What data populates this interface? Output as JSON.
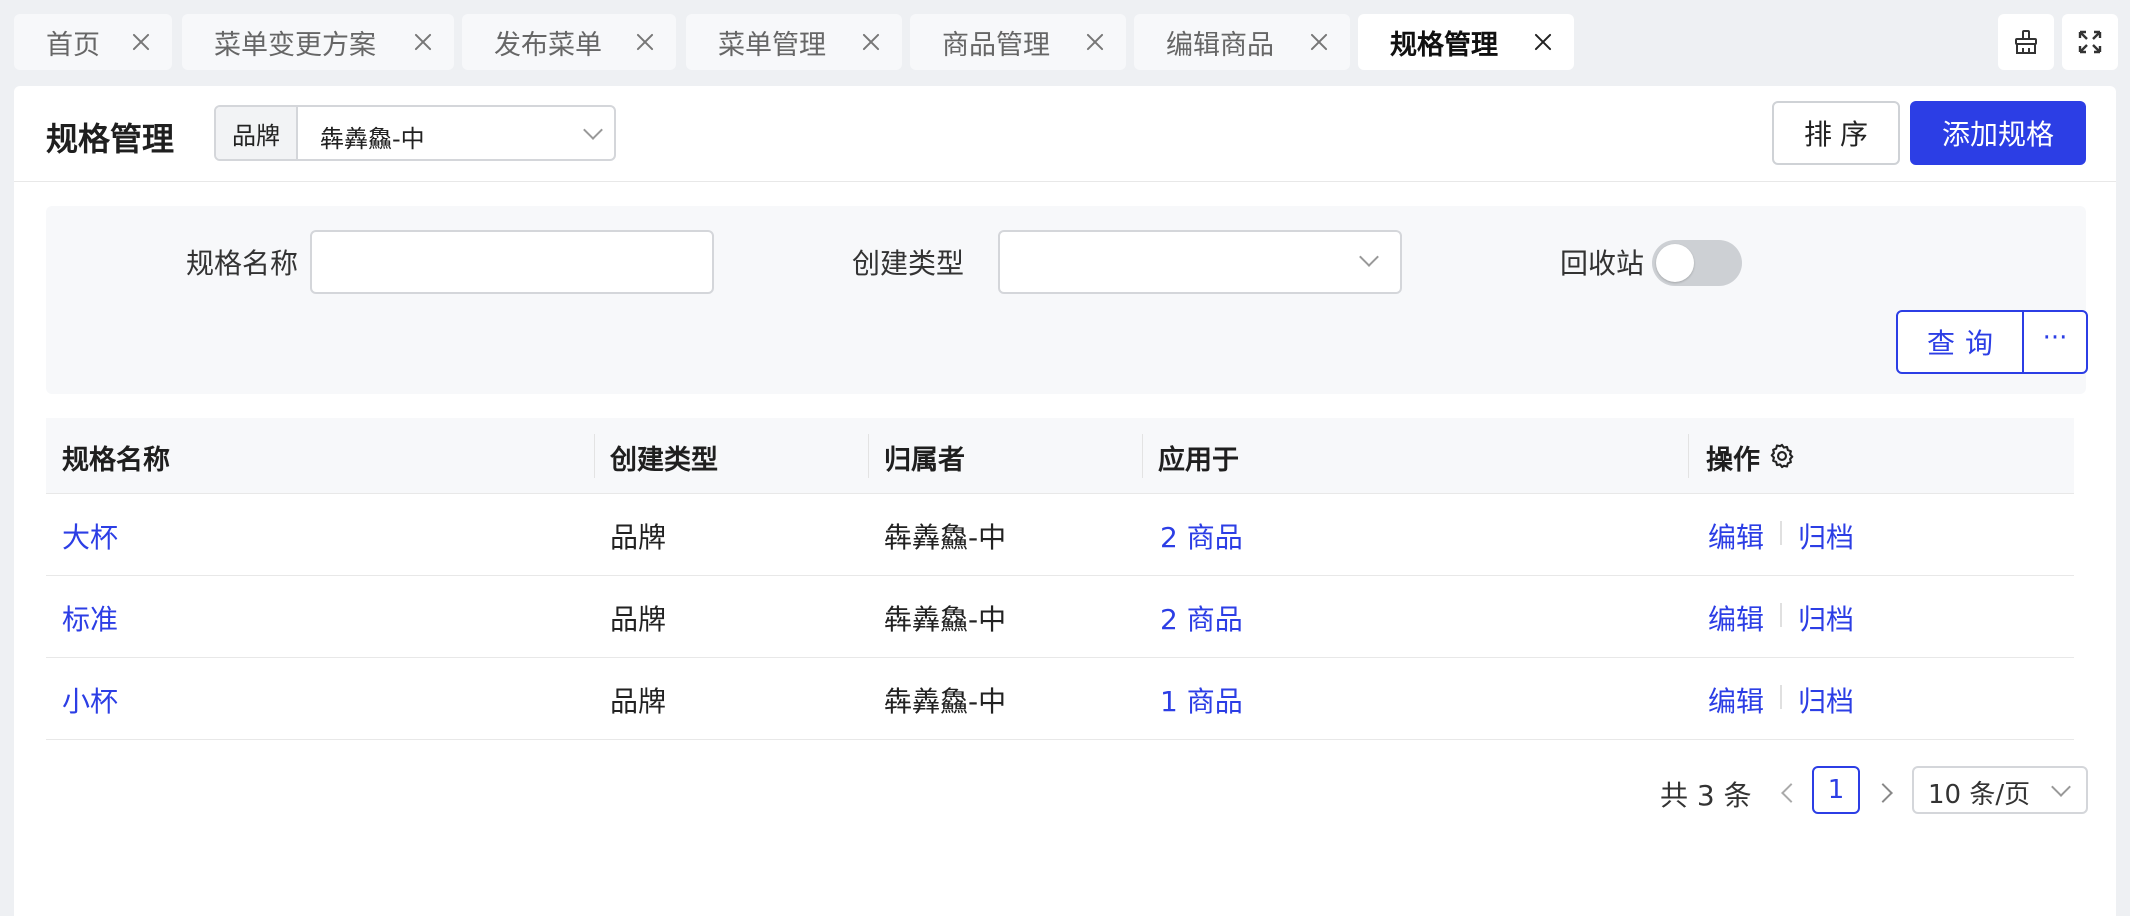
{
  "tabs": [
    {
      "label": "首页",
      "active": false
    },
    {
      "label": "菜单变更方案",
      "active": false
    },
    {
      "label": "发布菜单",
      "active": false
    },
    {
      "label": "菜单管理",
      "active": false
    },
    {
      "label": "商品管理",
      "active": false
    },
    {
      "label": "编辑商品",
      "active": false
    },
    {
      "label": "规格管理",
      "active": true
    }
  ],
  "toolbar_icons": [
    "broom-icon",
    "fullscreen-icon"
  ],
  "header": {
    "title": "规格管理",
    "brand_addon": "品牌",
    "brand_value": "犇羴鱻-中",
    "sort_label": "排序",
    "add_label": "添加规格"
  },
  "filters": {
    "name_label": "规格名称",
    "name_value": "",
    "type_label": "创建类型",
    "type_value": "",
    "recycle_label": "回收站",
    "recycle_on": false,
    "query_label": "查询",
    "more_label": "···"
  },
  "table": {
    "columns": {
      "name": "规格名称",
      "type": "创建类型",
      "owner": "归属者",
      "applied": "应用于",
      "ops": "操作"
    },
    "rows": [
      {
        "name": "大杯",
        "type": "品牌",
        "owner": "犇羴鱻-中",
        "applied": "2 商品",
        "edit": "编辑",
        "archive": "归档"
      },
      {
        "name": "标准",
        "type": "品牌",
        "owner": "犇羴鱻-中",
        "applied": "2 商品",
        "edit": "编辑",
        "archive": "归档"
      },
      {
        "name": "小杯",
        "type": "品牌",
        "owner": "犇羴鱻-中",
        "applied": "1 商品",
        "edit": "编辑",
        "archive": "归档"
      }
    ]
  },
  "pagination": {
    "total": "共 3 条",
    "current": "1",
    "page_size": "10 条/页"
  },
  "colors": {
    "primary": "#2c3ee5",
    "background": "#eef0f3",
    "panel": "#f7f8fa"
  }
}
